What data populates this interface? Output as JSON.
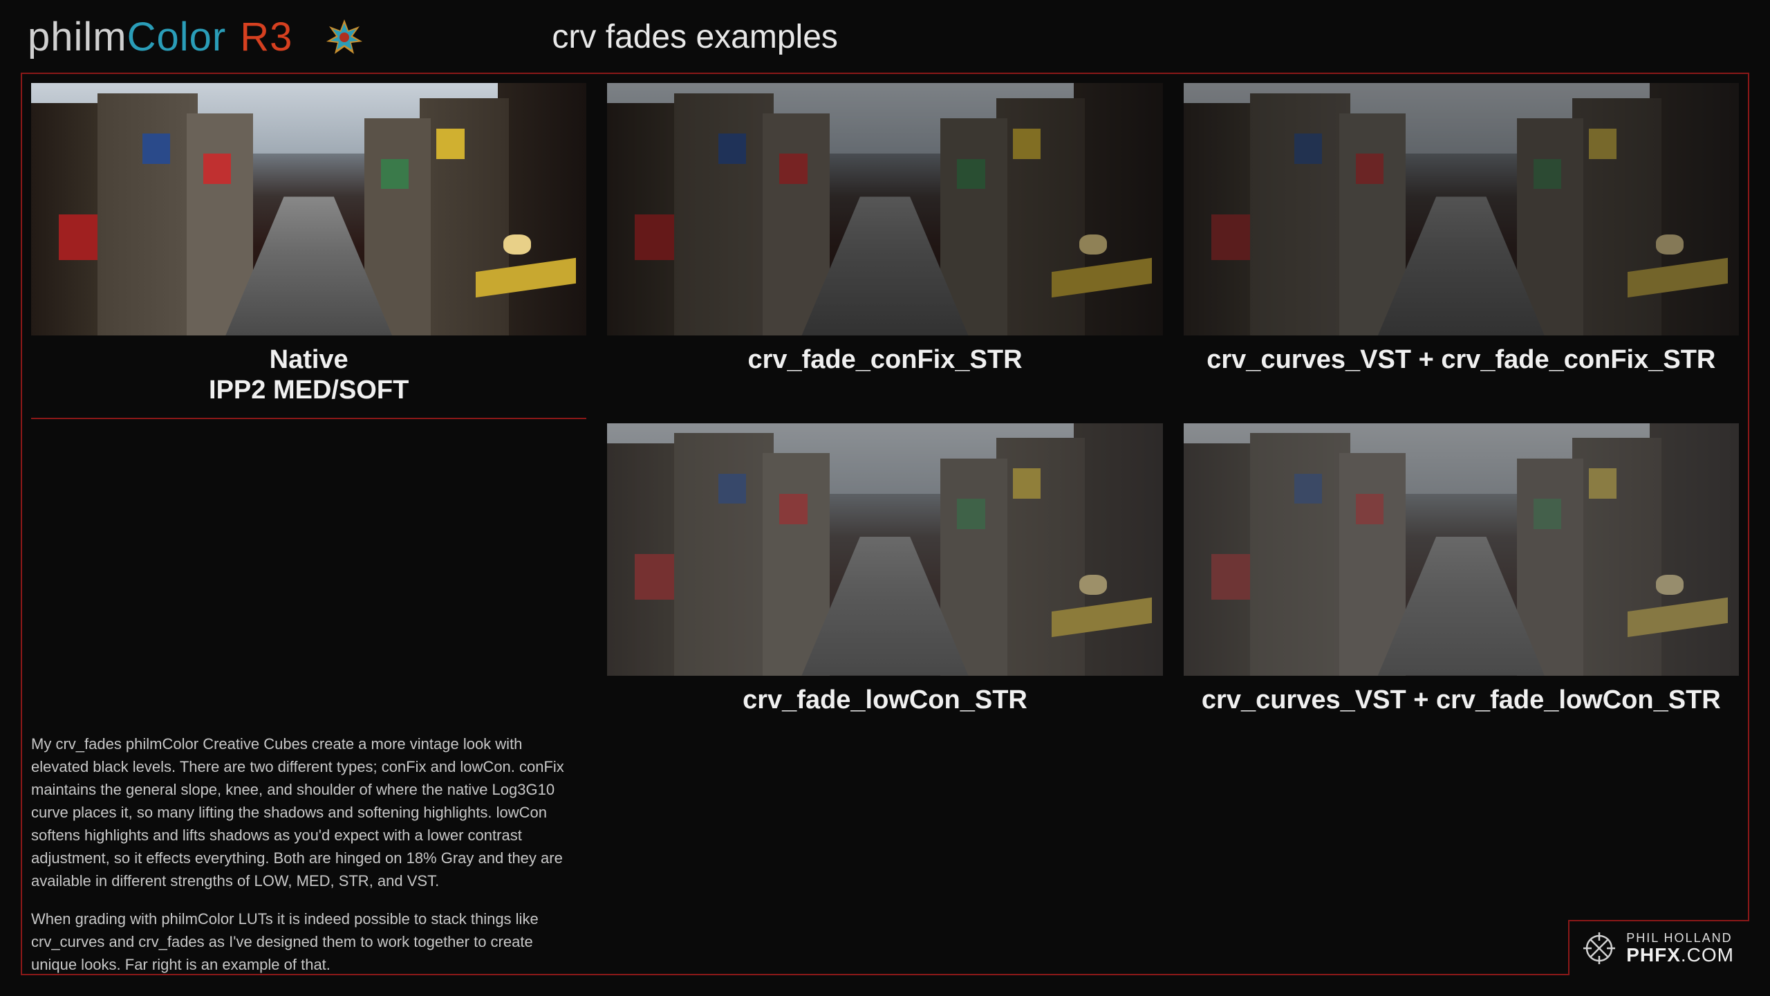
{
  "logo": {
    "part1": "philm",
    "part2": "Color",
    "part3": "R3"
  },
  "page_title": "crv fades examples",
  "cells": {
    "native": "Native\nIPP2 MED/SOFT",
    "c1": "crv_fade_conFix_STR",
    "c2": "crv_curves_VST + crv_fade_conFix_STR",
    "c3": "crv_fade_lowCon_STR",
    "c4": "crv_curves_VST + crv_fade_lowCon_STR"
  },
  "body": {
    "p1": "My crv_fades philmColor Creative Cubes create a more vintage look with elevated black levels.  There are two different types; conFix and lowCon.  conFix maintains the general slope, knee, and shoulder of where the native Log3G10 curve places it, so many lifting the shadows and softening highlights.  lowCon softens highlights and lifts shadows as you'd expect with a lower contrast adjustment, so it effects everything.  Both are hinged on 18% Gray and they are available in different strengths of LOW, MED, STR, and VST.",
    "p2": "When grading with philmColor LUTs it is indeed possible to stack things like crv_curves and crv_fades as I've designed them to work together to create unique looks.  Far right is an example of that."
  },
  "footer": {
    "name": "PHIL HOLLAND",
    "site_main": "PHFX",
    "site_ext": ".COM"
  }
}
